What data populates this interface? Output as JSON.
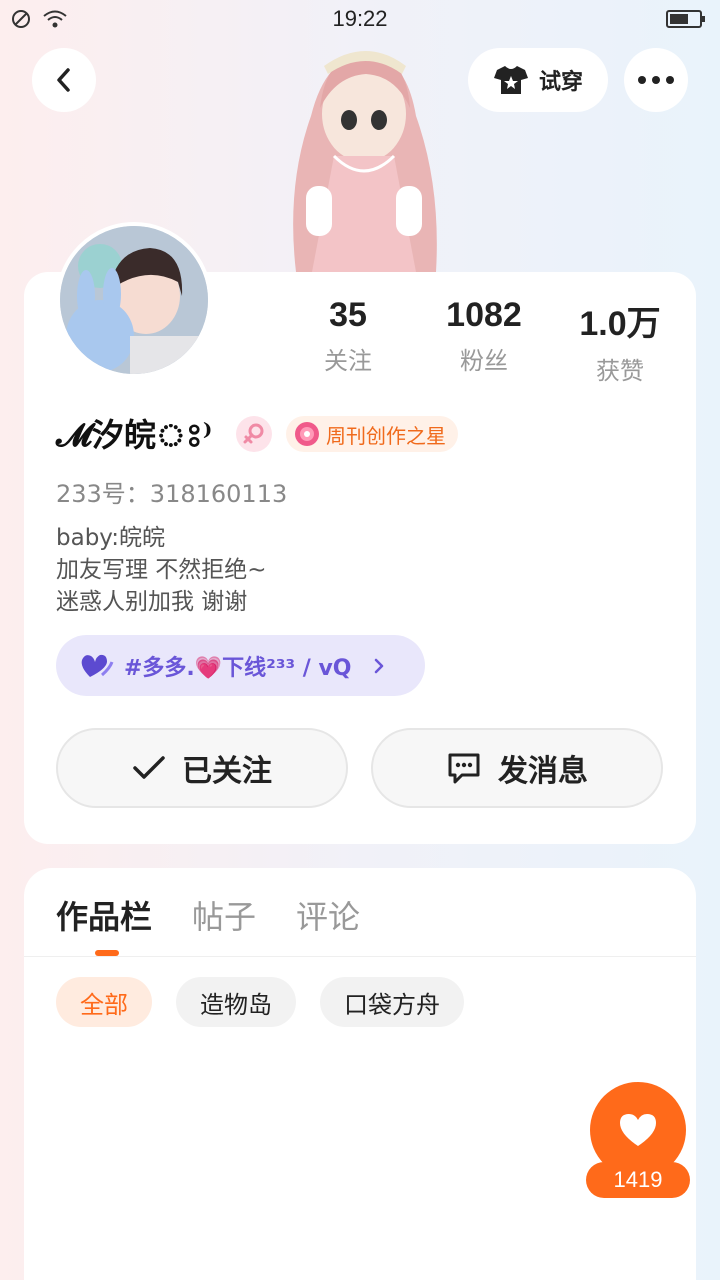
{
  "status_bar": {
    "time": "19:22"
  },
  "header": {
    "tryon_label": "试穿"
  },
  "profile": {
    "stats": [
      {
        "value": "35",
        "label": "关注"
      },
      {
        "value": "1082",
        "label": "粉丝"
      },
      {
        "value": "1.0万",
        "label": "获赞"
      }
    ],
    "nickname": "𝓜汐皖ঃ⁾",
    "badge_label": "周刊创作之星",
    "user_id": "233号：318160113",
    "bio": [
      "baby:皖皖",
      "加友写理 不然拒绝~",
      "迷惑人别加我 谢谢"
    ],
    "tag": "#多多.💗下线²³³ / vQ",
    "follow_label": "已关注",
    "message_label": "发消息"
  },
  "tabs": [
    "作品栏",
    "帖子",
    "评论"
  ],
  "chips": [
    "全部",
    "造物岛",
    "口袋方舟"
  ],
  "like_count": "1419",
  "colors": {
    "accent": "#ff6a1a",
    "tag_text": "#6a56d8"
  }
}
